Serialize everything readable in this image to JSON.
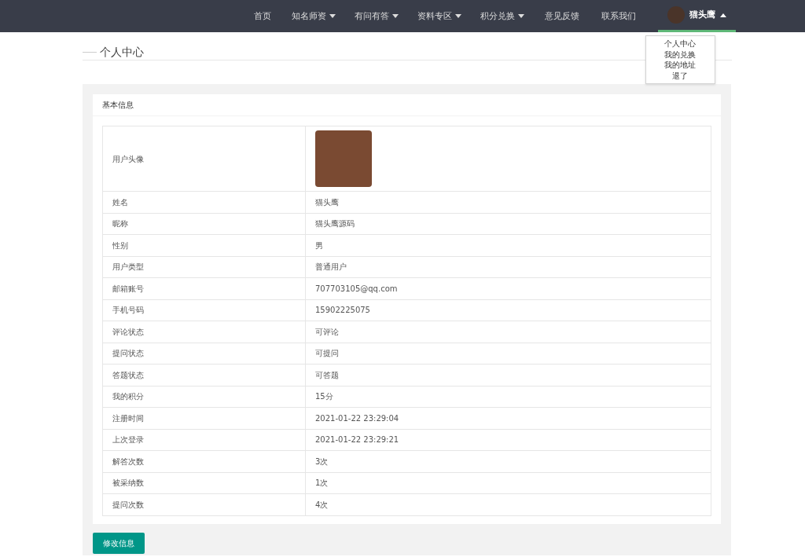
{
  "nav": {
    "items": [
      {
        "kind": "link",
        "label": "首页"
      },
      {
        "kind": "dropdown",
        "label": "知名师资"
      },
      {
        "kind": "dropdown",
        "label": "有问有答"
      },
      {
        "kind": "dropdown",
        "label": "资料专区"
      },
      {
        "kind": "dropdown",
        "label": "积分兑换"
      },
      {
        "kind": "link",
        "label": "意见反馈"
      },
      {
        "kind": "link",
        "label": "联系我们"
      }
    ],
    "user": {
      "name": "猫头鹰",
      "expanded": true,
      "selected": true,
      "menu": [
        "个人中心",
        "我的兑换",
        "我的地址",
        "退了"
      ]
    }
  },
  "page_title": "个人中心",
  "card": {
    "title": "基本信息",
    "rows": [
      {
        "kind": "image",
        "label": "用户头像"
      },
      {
        "kind": "text",
        "label": "姓名",
        "value": "猫头鹰"
      },
      {
        "kind": "text",
        "label": "昵称",
        "value": "猫头鹰源码"
      },
      {
        "kind": "text",
        "label": "性别",
        "value": "男"
      },
      {
        "kind": "text",
        "label": "用户类型",
        "value": "普通用户"
      },
      {
        "kind": "text",
        "label": "邮箱账号",
        "value": "707703105@qq.com"
      },
      {
        "kind": "text",
        "label": "手机号码",
        "value": "15902225075"
      },
      {
        "kind": "text",
        "label": "评论状态",
        "value": "可评论"
      },
      {
        "kind": "text",
        "label": "提问状态",
        "value": "可提问"
      },
      {
        "kind": "text",
        "label": "答题状态",
        "value": "可答题"
      },
      {
        "kind": "text",
        "label": "我的积分",
        "value": "15分"
      },
      {
        "kind": "text",
        "label": "注册时间",
        "value": "2021-01-22 23:29:04"
      },
      {
        "kind": "text",
        "label": "上次登录",
        "value": "2021-01-22 23:29:21"
      },
      {
        "kind": "text",
        "label": "解答次数",
        "value": "3次"
      },
      {
        "kind": "text",
        "label": "被采纳数",
        "value": "1次"
      },
      {
        "kind": "text",
        "label": "提问次数",
        "value": "4次"
      }
    ]
  },
  "edit_button": "修改信息"
}
